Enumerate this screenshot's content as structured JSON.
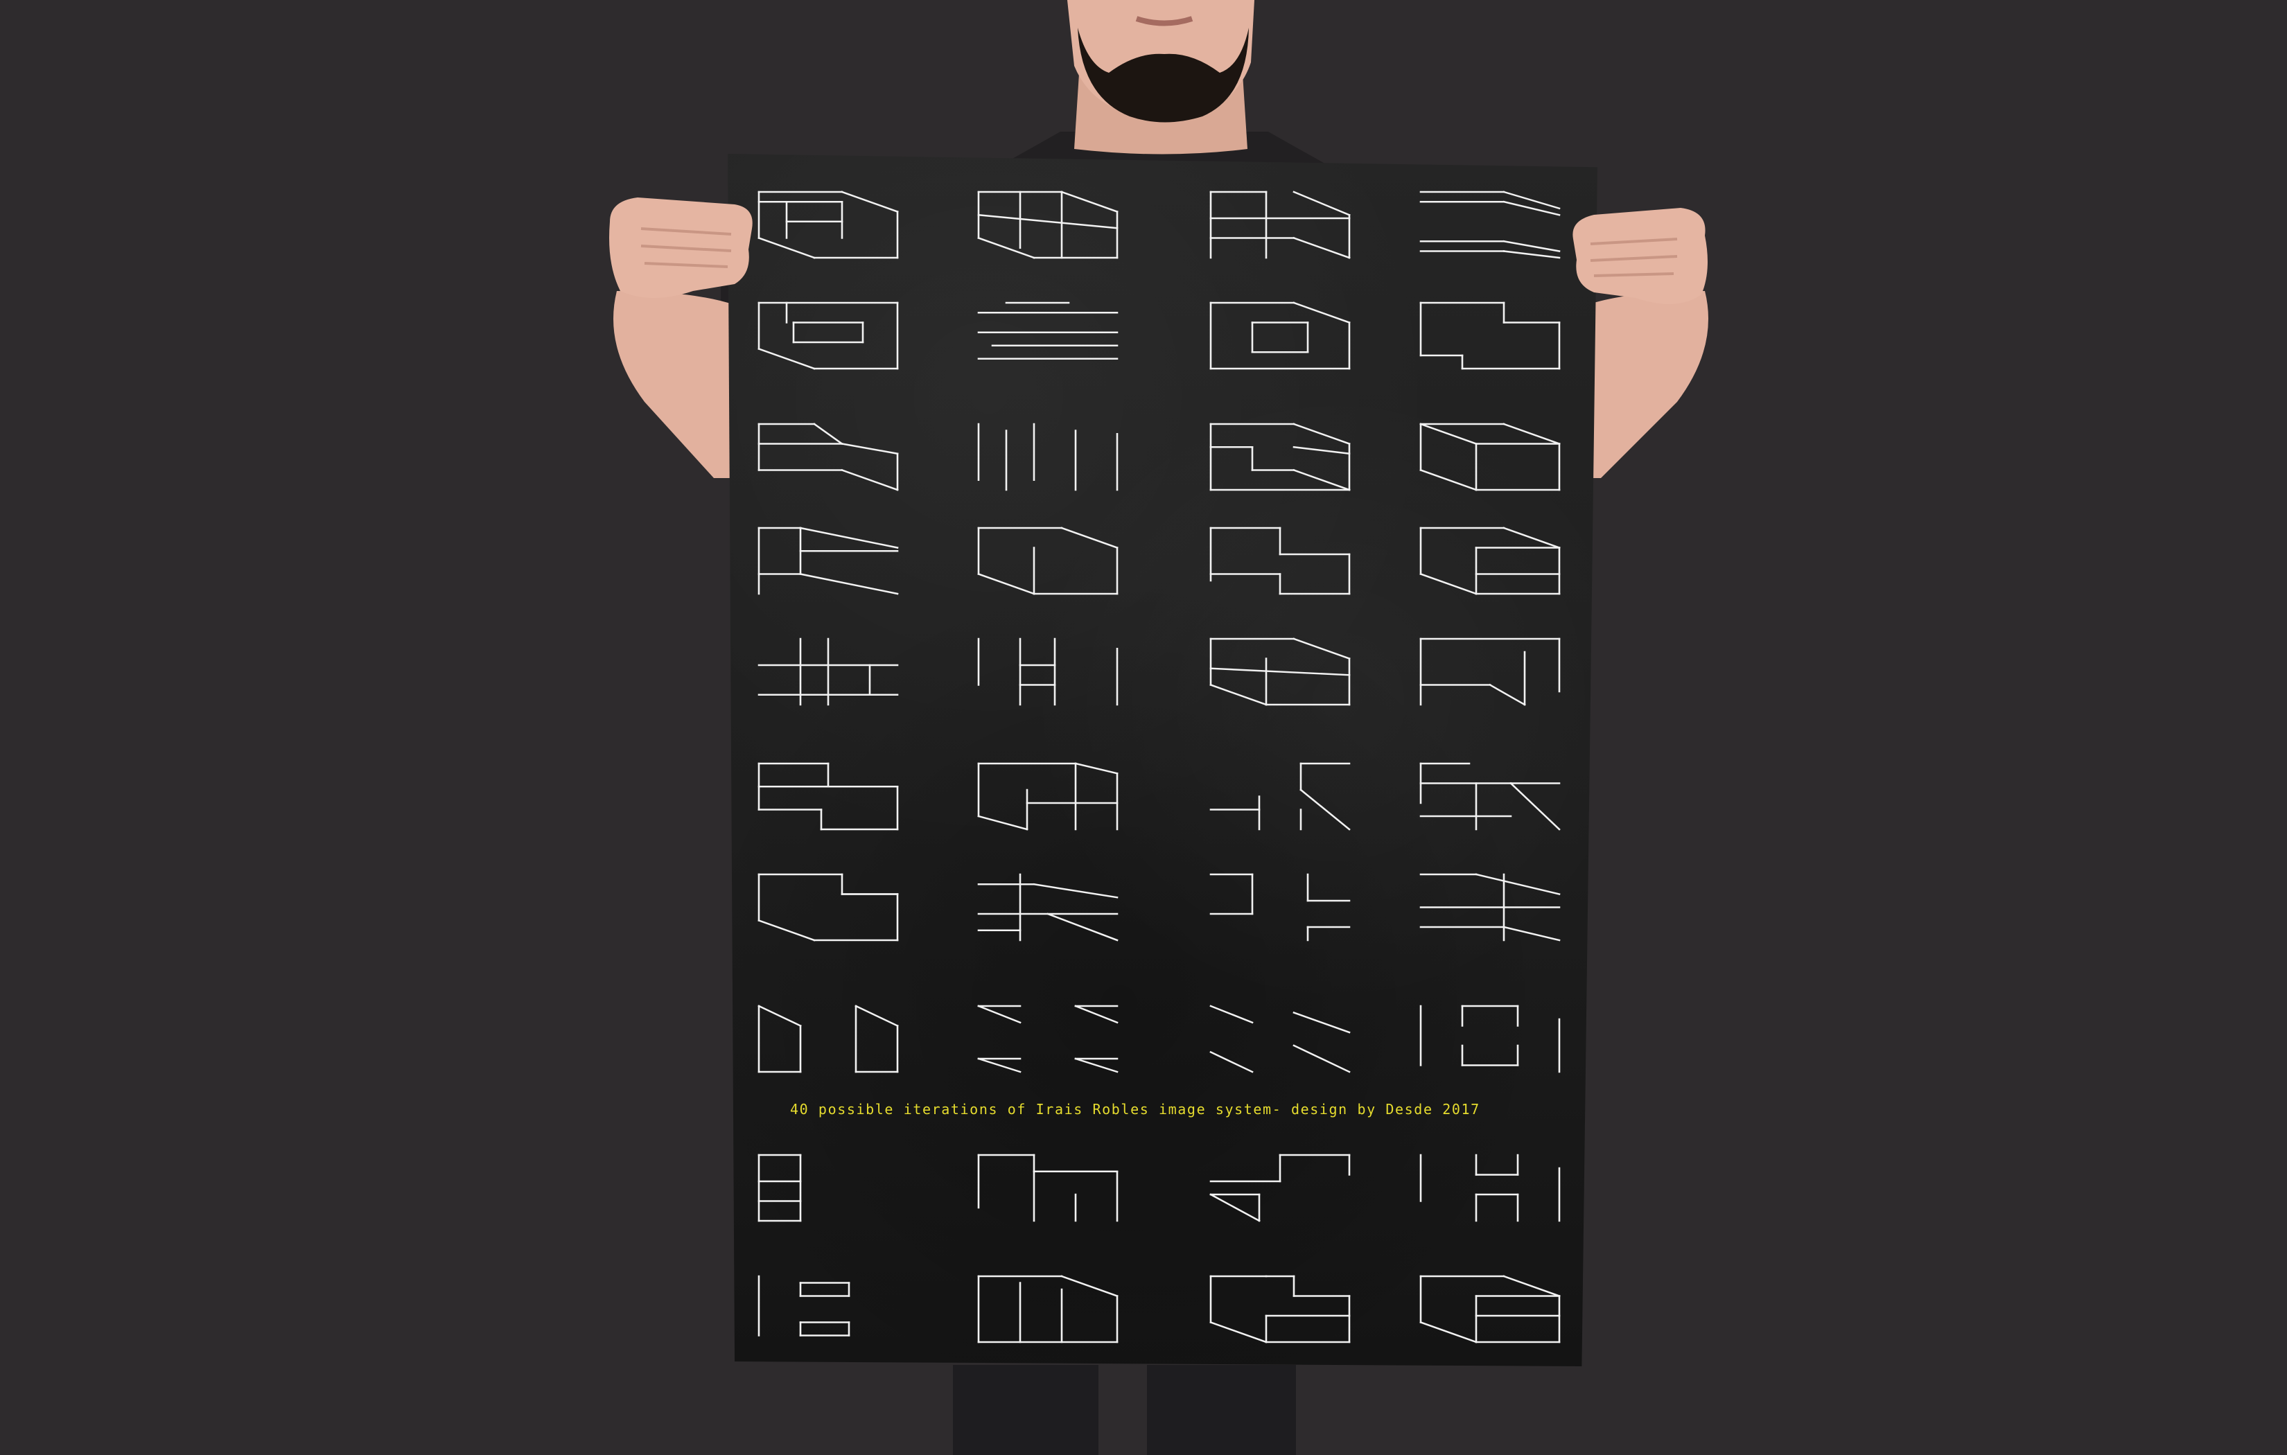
{
  "caption": "40 possible iterations of Irais Robles image system- design by Desde 2017",
  "colors": {
    "background": "#2e2b2d",
    "poster": "#1f1f1f",
    "glyph_stroke": "#f2f2f2",
    "caption": "#e6dc2e",
    "skin": "#e7b7a5",
    "hair": "#1a1411"
  },
  "glyph_count": 40
}
